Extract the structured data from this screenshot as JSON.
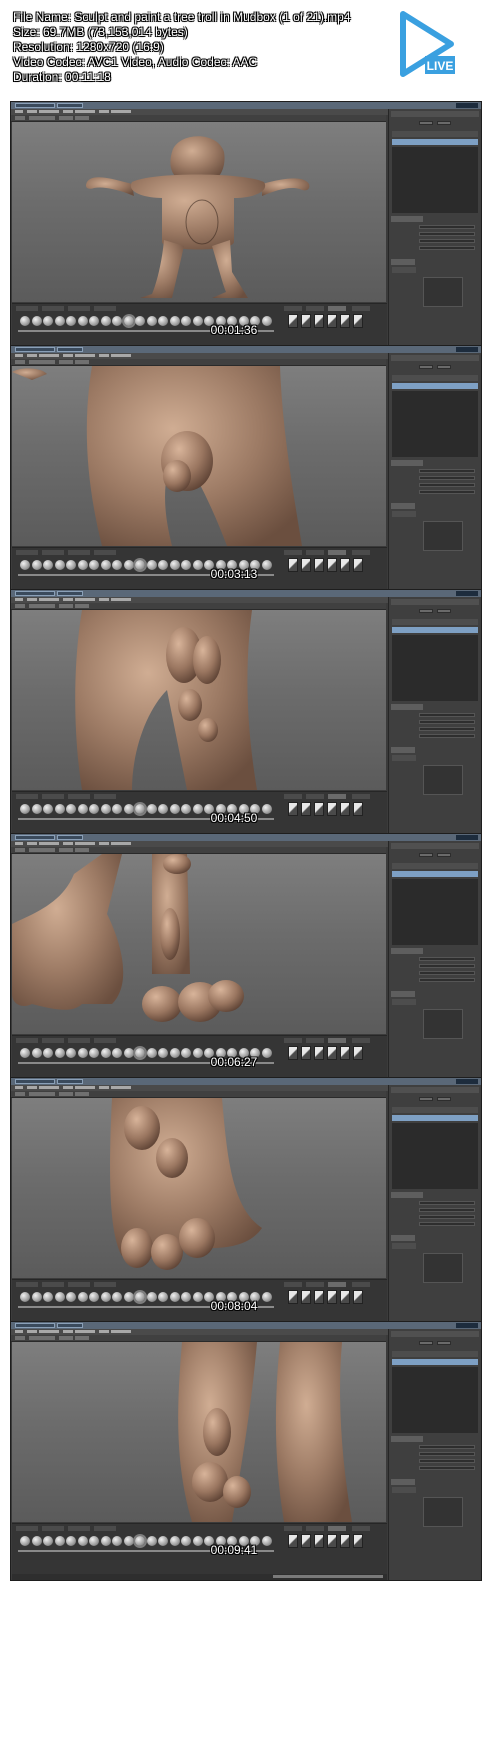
{
  "header": {
    "file_name": "File Name: Sculpt and paint a tree troll in Mudbox (1 of 21).mp4",
    "size": "Size: 69.7MB (73,153,014 bytes)",
    "resolution": "Resolution: 1280x720 (16:9)",
    "video_codec": "Video Codec: AVC1 Video, Audio Codec: AAC",
    "duration": "Duration: 00:11:18",
    "logo_label": "LIVE",
    "logo_icon": "play-triangle-icon",
    "logo_color": "#3aa0e0"
  },
  "frames": [
    {
      "timestamp": "00:01:36",
      "scene": "full-figure",
      "selected_tool": 9
    },
    {
      "timestamp": "00:03:13",
      "scene": "knee-lump",
      "selected_tool": 10
    },
    {
      "timestamp": "00:04:50",
      "scene": "leg-lumps",
      "selected_tool": 10
    },
    {
      "timestamp": "00:06:27",
      "scene": "feet-lumps",
      "selected_tool": 10
    },
    {
      "timestamp": "00:08:04",
      "scene": "foot-closeup",
      "selected_tool": 10
    },
    {
      "timestamp": "00:09:41",
      "scene": "legs-closeup",
      "selected_tool": 10
    }
  ],
  "colors": {
    "model_skin": "#9c7a64",
    "model_highlight": "#d0ad93",
    "model_shadow": "#6b4f3f",
    "ui_dark": "#3b3b3b",
    "selection_blue": "#7ea0c4"
  }
}
